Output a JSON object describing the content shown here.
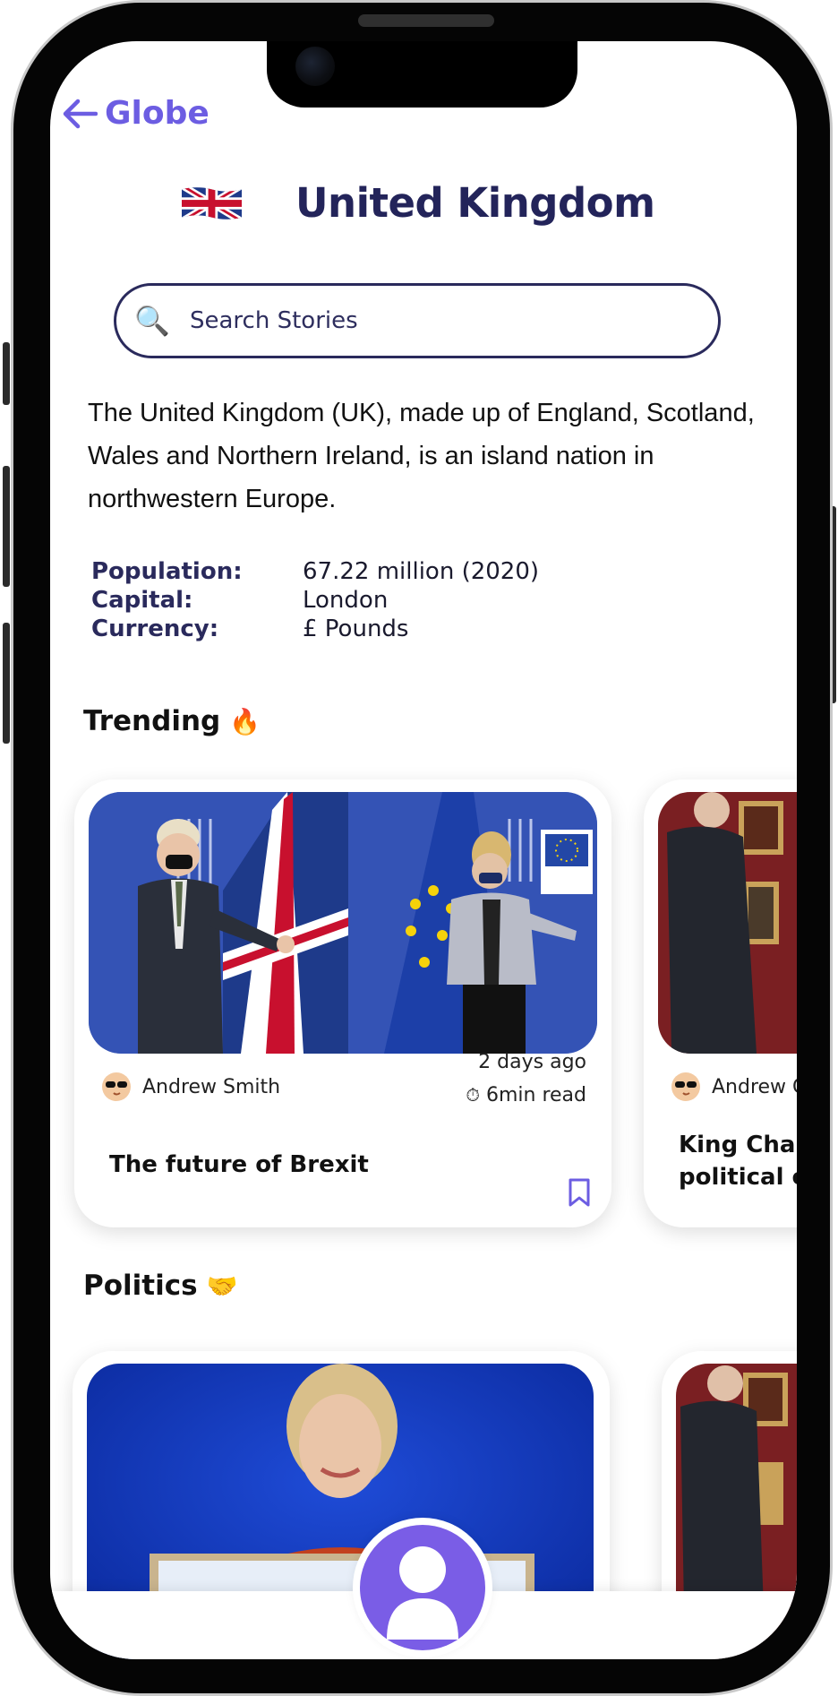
{
  "nav": {
    "back_label": "Globe"
  },
  "country": {
    "name": "United Kingdom",
    "flag_icon": "uk-flag-icon"
  },
  "search": {
    "placeholder": "Search Stories",
    "icon": "magnifier-icon"
  },
  "description": "The United Kingdom (UK), made up of England, Scotland, Wales and Northern Ireland, is an island nation in northwestern Europe.",
  "facts": [
    {
      "label": "Population:",
      "value": "67.22 million (2020)"
    },
    {
      "label": "Capital:",
      "value": "London"
    },
    {
      "label": "Currency:",
      "value": "£ Pounds"
    }
  ],
  "trending": {
    "title": "Trending",
    "emoji": "🔥",
    "cards": [
      {
        "author": "Andrew Smith",
        "time": "2 days ago",
        "read_time": "6min read",
        "title": "The future of Brexit"
      },
      {
        "author": "Andrew G",
        "title_line1": "King Char",
        "title_line2": "political c"
      }
    ]
  },
  "politics": {
    "title": "Politics",
    "emoji": "🤝"
  },
  "colors": {
    "accent": "#6c5de2",
    "navy": "#23245a",
    "profile": "#7a5de6"
  }
}
